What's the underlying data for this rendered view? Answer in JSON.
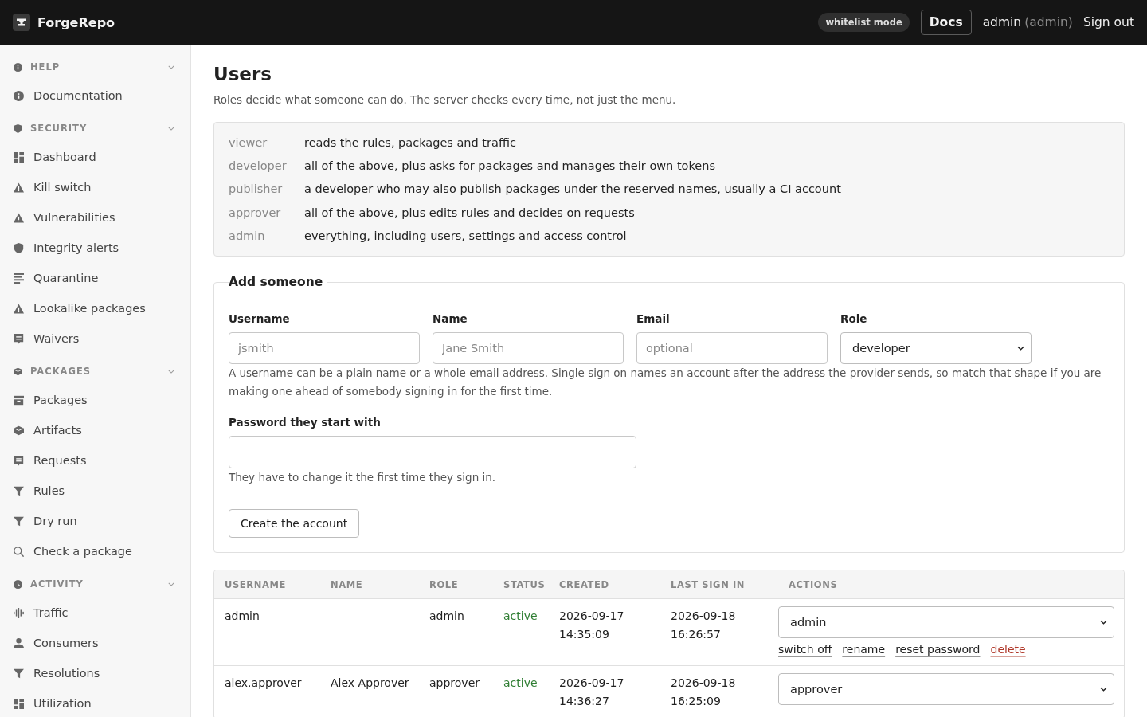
{
  "topbar": {
    "brand": "ForgeRepo",
    "mode_badge": "whitelist mode",
    "docs_button": "Docs",
    "user": "admin",
    "user_role": "(admin)",
    "sign_out": "Sign out"
  },
  "sidebar": {
    "sections": [
      {
        "title": "HELP",
        "kind": "info",
        "expanded": true,
        "items": [
          {
            "label": "Documentation",
            "kind": "info",
            "selected": false
          }
        ]
      },
      {
        "title": "SECURITY",
        "kind": "shield",
        "expanded": true,
        "items": [
          {
            "label": "Dashboard",
            "kind": "grid",
            "selected": false
          },
          {
            "label": "Kill switch",
            "kind": "warning",
            "selected": false
          },
          {
            "label": "Vulnerabilities",
            "kind": "warning",
            "selected": false
          },
          {
            "label": "Integrity alerts",
            "kind": "shield",
            "selected": false
          },
          {
            "label": "Quarantine",
            "kind": "lines",
            "selected": false
          },
          {
            "label": "Lookalike packages",
            "kind": "warning",
            "selected": false
          },
          {
            "label": "Waivers",
            "kind": "comment",
            "selected": false
          }
        ]
      },
      {
        "title": "PACKAGES",
        "kind": "cube",
        "expanded": true,
        "items": [
          {
            "label": "Packages",
            "kind": "archive",
            "selected": false
          },
          {
            "label": "Artifacts",
            "kind": "cube",
            "selected": false
          },
          {
            "label": "Requests",
            "kind": "comment",
            "selected": false
          },
          {
            "label": "Rules",
            "kind": "filter",
            "selected": false
          },
          {
            "label": "Dry run",
            "kind": "filter",
            "selected": false
          },
          {
            "label": "Check a package",
            "kind": "search",
            "selected": false
          }
        ]
      },
      {
        "title": "ACTIVITY",
        "kind": "clock",
        "expanded": true,
        "items": [
          {
            "label": "Traffic",
            "kind": "bars",
            "selected": false
          },
          {
            "label": "Consumers",
            "kind": "user",
            "selected": false
          },
          {
            "label": "Resolutions",
            "kind": "filter",
            "selected": false
          },
          {
            "label": "Utilization",
            "kind": "grid",
            "selected": false
          }
        ]
      }
    ]
  },
  "page": {
    "title": "Users",
    "subtitle": "Roles decide what someone can do. The server checks every time, not just the menu."
  },
  "roles": [
    {
      "role": "viewer",
      "description": "reads the rules, packages and traffic"
    },
    {
      "role": "developer",
      "description": "all of the above, plus asks for packages and manages their own tokens"
    },
    {
      "role": "publisher",
      "description": "a developer who may also publish packages under the reserved names, usually a CI account"
    },
    {
      "role": "approver",
      "description": "all of the above, plus edits rules and decides on requests"
    },
    {
      "role": "admin",
      "description": "everything, including users, settings and access control"
    }
  ],
  "add_form": {
    "legend": "Add someone",
    "fields": [
      {
        "label": "Username",
        "kind": "text",
        "placeholder": "jsmith"
      },
      {
        "label": "Name",
        "kind": "text",
        "placeholder": "Jane Smith"
      },
      {
        "label": "Email",
        "kind": "text",
        "placeholder": "optional"
      },
      {
        "label": "Role",
        "kind": "select",
        "value": "developer"
      }
    ],
    "hint": "A username can be a plain name or a whole email address. Single sign on names an account after the address the provider sends, so match that shape if you are making one ahead of somebody signing in for the first time.",
    "password": {
      "label": "Password they start with",
      "hint": "They have to change it the first time they sign in."
    },
    "submit": "Create the account"
  },
  "users_table": {
    "columns": [
      "USERNAME",
      "NAME",
      "ROLE",
      "STATUS",
      "CREATED",
      "LAST SIGN IN",
      "ACTIONS"
    ],
    "rows": [
      {
        "username": "admin",
        "role": "admin",
        "status": "active",
        "active": true,
        "created": "2026-09-17 14:35:09",
        "last_sign_in": "2026-09-18 16:26:57",
        "role_choice": "admin",
        "actions": [
          {
            "label": "switch off",
            "kind": "link"
          },
          {
            "label": "rename",
            "kind": "link"
          },
          {
            "label": "reset password",
            "kind": "link"
          },
          {
            "label": "delete",
            "kind": "danger"
          }
        ]
      },
      {
        "username": "alex.approver",
        "name": "Alex Approver",
        "role": "approver",
        "status": "active",
        "active": true,
        "created": "2026-09-17 14:36:27",
        "last_sign_in": "2026-09-18 16:25:09",
        "role_choice": "approver"
      }
    ]
  }
}
